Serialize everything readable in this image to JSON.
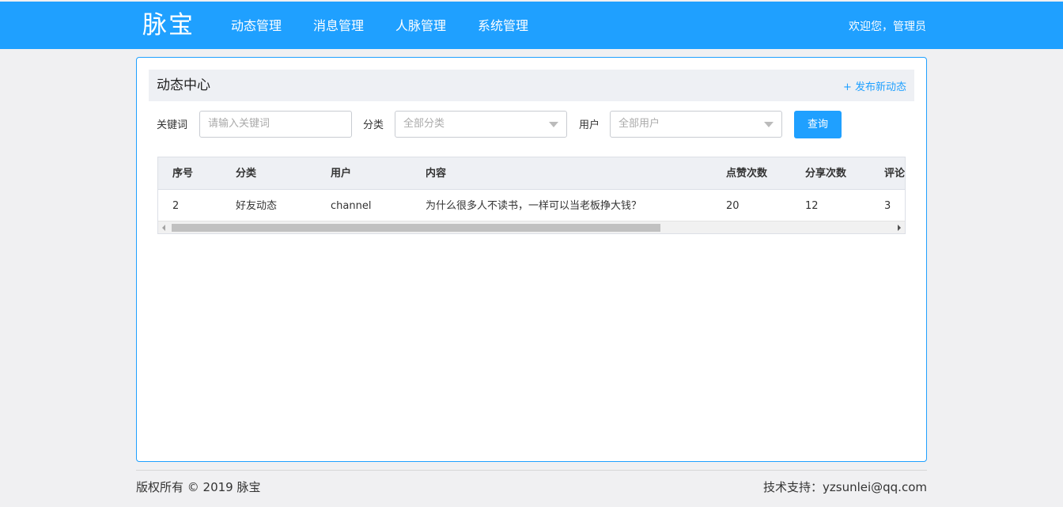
{
  "header": {
    "logo": "脉宝",
    "nav": [
      "动态管理",
      "消息管理",
      "人脉管理",
      "系统管理"
    ],
    "welcome": "欢迎您，管理员"
  },
  "panel": {
    "title": "动态中心",
    "publish_link": "+ 发布新动态"
  },
  "filters": {
    "keyword_label": "关键词",
    "keyword_placeholder": "请输入关键词",
    "category_label": "分类",
    "category_value": "全部分类",
    "user_label": "用户",
    "user_value": "全部用户",
    "query_button": "查询"
  },
  "table": {
    "columns": [
      "序号",
      "分类",
      "用户",
      "内容",
      "点赞次数",
      "分享次数",
      "评论"
    ],
    "rows": [
      [
        "2",
        "好友动态",
        "channel",
        "为什么很多人不读书，一样可以当老板挣大钱？",
        "20",
        "12",
        "3"
      ]
    ]
  },
  "footer": {
    "copyright": "版权所有 © 2019 脉宝",
    "support": "技术支持：yzsunlei@qq.com"
  }
}
